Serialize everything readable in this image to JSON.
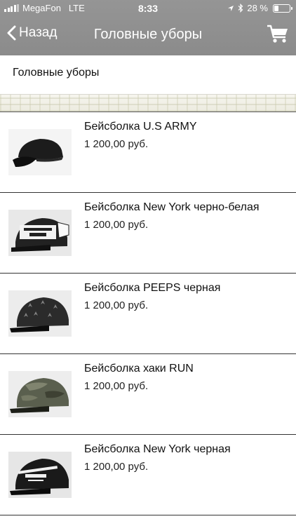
{
  "status_bar": {
    "carrier": "MegaFon",
    "network": "LTE",
    "time": "8:33",
    "battery": "28 %",
    "battery_level": 0.28
  },
  "nav": {
    "back_label": "Назад",
    "title": "Головные уборы"
  },
  "category": {
    "title": "Головные уборы"
  },
  "products": [
    {
      "name": "Бейсболка U.S ARMY",
      "price": "1 200,00 руб."
    },
    {
      "name": "Бейсболка New York черно-белая",
      "price": "1 200,00 руб."
    },
    {
      "name": "Бейсболка PEEPS черная",
      "price": "1 200,00 руб."
    },
    {
      "name": "Бейсболка хаки RUN",
      "price": "1 200,00 руб."
    },
    {
      "name": "Бейсболка New York черная",
      "price": "1 200,00 руб."
    }
  ],
  "colors": {
    "bar": "#909090",
    "text": "#111111",
    "divider": "#333333"
  }
}
